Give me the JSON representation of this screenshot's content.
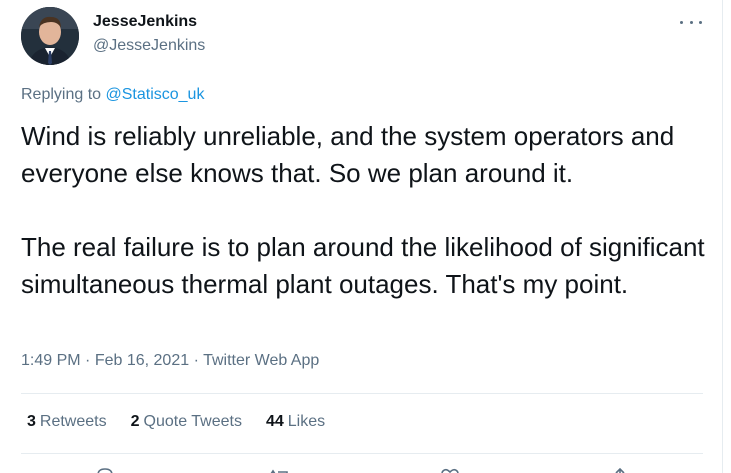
{
  "tweet": {
    "author": {
      "display_name": "JesseJenkins",
      "handle": "@JesseJenkins"
    },
    "more_icon": "more-dots-icon",
    "reply": {
      "prefix": "Replying to",
      "mention": "@Statisco_uk"
    },
    "text": {
      "paragraph1": "Wind is reliably unreliable, and the system operators and everyone else knows that. So we plan around it.",
      "paragraph2": "The real failure is to plan around the likelihood of significant simultaneous thermal plant outages. That's my point."
    },
    "meta": {
      "time": "1:49 PM",
      "separator": "·",
      "date": "Feb 16, 2021",
      "source": "Twitter Web App"
    },
    "stats": [
      {
        "count": "3",
        "label": "Retweets"
      },
      {
        "count": "2",
        "label": "Quote Tweets"
      },
      {
        "count": "44",
        "label": "Likes"
      }
    ],
    "actions": [
      "reply-icon",
      "retweet-icon",
      "like-icon",
      "share-icon"
    ]
  },
  "colors": {
    "text": "#0f1419",
    "secondary": "#5b7083",
    "link": "#1b95e0",
    "divider": "#e6ecf0"
  }
}
